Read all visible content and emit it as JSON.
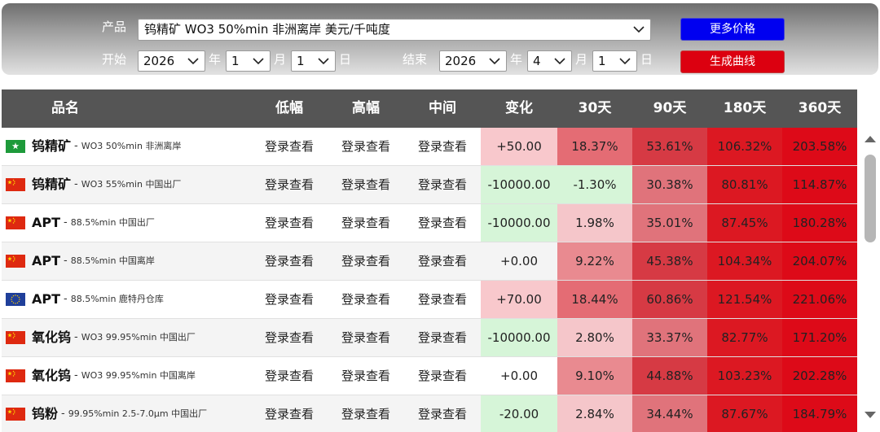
{
  "filters": {
    "product_label": "产品",
    "product_value": "钨精矿 WO3 50%min 非洲离岸 美元/千吨度",
    "start_label": "开始",
    "end_label": "结束",
    "start": {
      "year": "2026",
      "month": "1",
      "day": "1"
    },
    "end": {
      "year": "2026",
      "month": "4",
      "day": "1"
    },
    "unit_year": "年",
    "unit_month": "月",
    "unit_day": "日",
    "more_prices_btn": "更多价格",
    "generate_curve_btn": "生成曲线"
  },
  "table": {
    "headers": [
      "品名",
      "低幅",
      "高幅",
      "中间",
      "变化",
      "30天",
      "90天",
      "180天",
      "360天"
    ],
    "rows": [
      {
        "flag": "africa",
        "name": "钨精矿",
        "spec": "WO3 50%min 非洲离岸",
        "low": "登录查看",
        "high": "登录查看",
        "mid": "登录查看",
        "change": "+50.00",
        "d30": "18.37%",
        "d90": "53.61%",
        "d180": "106.32%",
        "d360": "203.58%"
      },
      {
        "flag": "cn",
        "name": "钨精矿",
        "spec": "WO3 55%min 中国出厂",
        "low": "登录查看",
        "high": "登录查看",
        "mid": "登录查看",
        "change": "-10000.00",
        "d30": "-1.30%",
        "d90": "30.38%",
        "d180": "80.81%",
        "d360": "114.87%"
      },
      {
        "flag": "cn",
        "name": "APT",
        "spec": "88.5%min 中国出厂",
        "low": "登录查看",
        "high": "登录查看",
        "mid": "登录查看",
        "change": "-10000.00",
        "d30": "1.98%",
        "d90": "35.01%",
        "d180": "87.45%",
        "d360": "180.28%"
      },
      {
        "flag": "cn",
        "name": "APT",
        "spec": "88.5%min 中国离岸",
        "low": "登录查看",
        "high": "登录查看",
        "mid": "登录查看",
        "change": "+0.00",
        "d30": "9.22%",
        "d90": "45.38%",
        "d180": "104.34%",
        "d360": "204.07%"
      },
      {
        "flag": "eu",
        "name": "APT",
        "spec": "88.5%min 鹿特丹仓库",
        "low": "登录查看",
        "high": "登录查看",
        "mid": "登录查看",
        "change": "+70.00",
        "d30": "18.44%",
        "d90": "60.86%",
        "d180": "121.54%",
        "d360": "221.06%"
      },
      {
        "flag": "cn",
        "name": "氧化钨",
        "spec": "WO3 99.95%min 中国出厂",
        "low": "登录查看",
        "high": "登录查看",
        "mid": "登录查看",
        "change": "-10000.00",
        "d30": "2.80%",
        "d90": "33.37%",
        "d180": "82.77%",
        "d360": "171.20%"
      },
      {
        "flag": "cn",
        "name": "氧化钨",
        "spec": "WO3 99.95%min 中国离岸",
        "low": "登录查看",
        "high": "登录查看",
        "mid": "登录查看",
        "change": "+0.00",
        "d30": "9.10%",
        "d90": "44.88%",
        "d180": "103.23%",
        "d360": "202.28%"
      },
      {
        "flag": "cn",
        "name": "钨粉",
        "spec": "99.95%min 2.5-7.0μm 中国出厂",
        "low": "登录查看",
        "high": "登录查看",
        "mid": "登录查看",
        "change": "-20.00",
        "d30": "2.84%",
        "d90": "34.44%",
        "d180": "87.67%",
        "d360": "184.79%"
      }
    ]
  },
  "colors": {
    "change_up": "#f8c8cc",
    "change_down": "#d6f5d8",
    "d30_low": "#f5c6ca",
    "d30_mid": "#e98a90",
    "d30_high": "#e46c74",
    "d30_neg": "#d6f5d8",
    "d90_low": "#e0737b",
    "d90_high": "#d63a44",
    "d180": "#dc1822",
    "d360": "#dd0a18",
    "header_bg": "#555555",
    "btn_blue": "#0000f0",
    "btn_red": "#dc0010"
  }
}
